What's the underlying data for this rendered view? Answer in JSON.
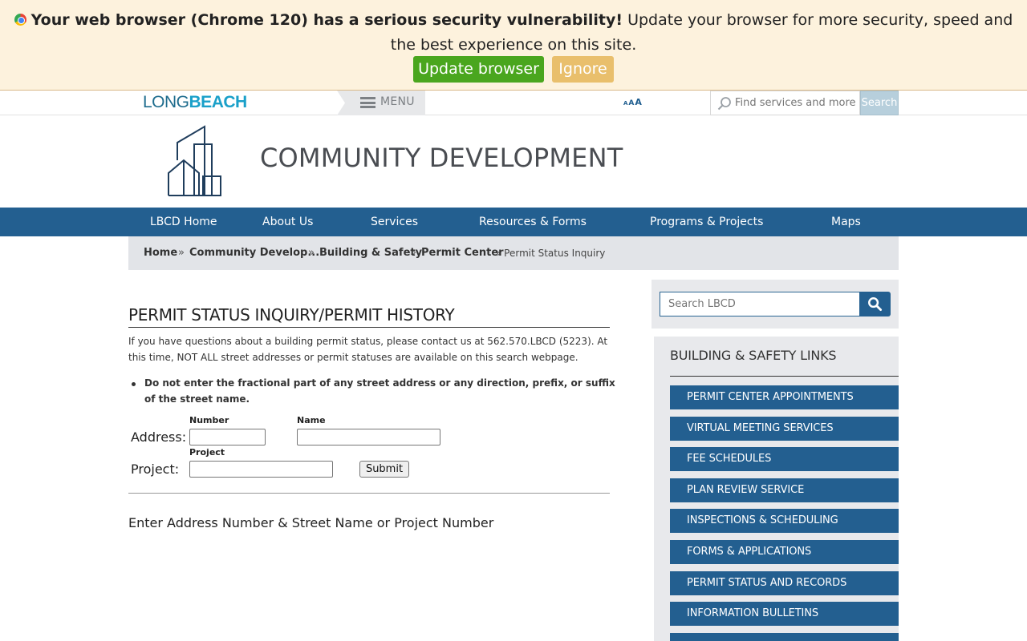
{
  "banner": {
    "bold_text": "Your web browser (Chrome 120) has a serious security vulnerability!",
    "text": "Update your browser for more security, speed and the best experience on this site.",
    "update_label": "Update browser",
    "ignore_label": "Ignore"
  },
  "utility": {
    "logo_part1": "LONG",
    "logo_part2": "BEACH",
    "menu_label": "MENU",
    "font_sizes": [
      "A",
      "A",
      "A"
    ],
    "search_placeholder": "Find services and more",
    "search_button": "Search"
  },
  "header": {
    "title": "COMMUNITY DEVELOPMENT"
  },
  "nav": {
    "items": [
      "LBCD Home",
      "About Us",
      "Services",
      "Resources & Forms",
      "Programs & Projects",
      "Maps"
    ]
  },
  "breadcrumb": {
    "items": [
      "Home",
      "Community Develop...",
      "Building & Safety",
      "Permit Center"
    ],
    "separator": "»",
    "current": "» Permit Status Inquiry"
  },
  "main": {
    "title": "PERMIT STATUS INQUIRY/PERMIT HISTORY",
    "intro": "If you have questions about a building permit status, please contact us at 562.570.LBCD (5223).  At this time, NOT ALL street addresses or permit statuses are available on this search webpage.",
    "note": "Do not enter the fractional part of any street address or any direction, prefix, or suffix of the street name.",
    "form": {
      "address_label": "Address:",
      "number_label": "Number",
      "name_label": "Name",
      "project_small_label": "Project",
      "project_label": "Project:",
      "number_value": "",
      "name_value": "",
      "project_value": "",
      "submit_label": "Submit"
    },
    "results_message": "Enter Address Number & Street Name or Project Number"
  },
  "sidebar": {
    "search_placeholder": "Search LBCD",
    "title": "BUILDING & SAFETY LINKS",
    "links": [
      "PERMIT CENTER APPOINTMENTS",
      "VIRTUAL MEETING SERVICES",
      "FEE SCHEDULES",
      "PLAN REVIEW SERVICE",
      "INSPECTIONS & SCHEDULING",
      "FORMS & APPLICATIONS",
      "PERMIT STATUS AND RECORDS",
      "INFORMATION BULLETINS"
    ]
  },
  "colors": {
    "nav_blue": "#235f90",
    "banner_bg": "#fdf2dd",
    "update_green": "#4aa61e",
    "ignore_orange": "#e9bf6c"
  }
}
